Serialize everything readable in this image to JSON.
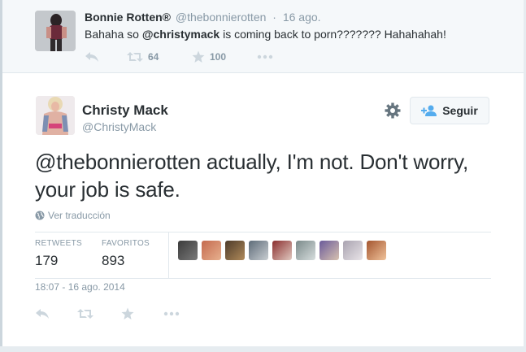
{
  "reply_tweet": {
    "author_name": "Bonnie Rotten®",
    "author_handle": "@thebonnierotten",
    "separator": "·",
    "time": "16 ago.",
    "text_before": "Bahaha so ",
    "text_mention": "@christymack",
    "text_after": " is coming back to porn???????  Hahahahah!",
    "retweet_count": "64",
    "favorite_count": "100"
  },
  "main_tweet": {
    "author_name": "Christy Mack",
    "author_handle": "@ChristyMack",
    "follow_label": "Seguir",
    "text": "@thebonnierotten actually, I'm not. Don't worry, your job is safe.",
    "translate_label": "Ver traducción",
    "retweets_label": "RETWEETS",
    "retweets_value": "179",
    "favorites_label": "FAVORITOS",
    "favorites_value": "893",
    "timestamp": "18:07 - 16 ago. 2014"
  },
  "colors": {
    "link_blue": "#55acee",
    "meta_gray": "#8899a6",
    "action_gray": "#ccd6dd",
    "text_dark": "#292f33"
  },
  "icons": [
    "reply-icon",
    "retweet-icon",
    "favorite-star-icon",
    "more-dots-icon",
    "gear-icon",
    "follow-user-plus-icon",
    "globe-icon"
  ]
}
